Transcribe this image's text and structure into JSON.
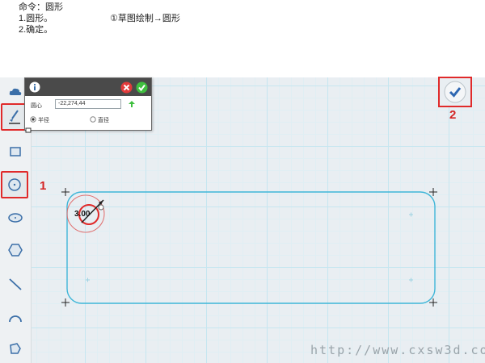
{
  "instructions": {
    "line1": "命令：圆形",
    "line2": "1.圆形。",
    "line3": "2.确定。",
    "note": "①草图绘制→圆形"
  },
  "toolbar": {
    "items": [
      {
        "name": "cloud-icon"
      },
      {
        "name": "sketch-brush-icon",
        "selected": true
      },
      {
        "name": "rectangle-icon"
      },
      {
        "name": "circle-icon",
        "selected": true
      },
      {
        "name": "ellipse-icon"
      },
      {
        "name": "hexagon-icon"
      },
      {
        "name": "line-icon"
      },
      {
        "name": "arc-icon"
      },
      {
        "name": "polygon-icon"
      }
    ]
  },
  "panel": {
    "info_icon": "info-icon",
    "cancel_icon": "cancel-icon",
    "ok_icon": "ok-icon",
    "center_label": "圆心",
    "center_value": "-22,274,44",
    "radius_label": "半径",
    "diameter_label": "直径",
    "radius_selected": true
  },
  "annotations": {
    "step1": "1",
    "step2": "2"
  },
  "sketch": {
    "dimension_text": "3.00",
    "stroke_color": "#3fb6d8",
    "highlight_color": "#e02a2a"
  },
  "watermark": "http://www.cxsw3d.com"
}
